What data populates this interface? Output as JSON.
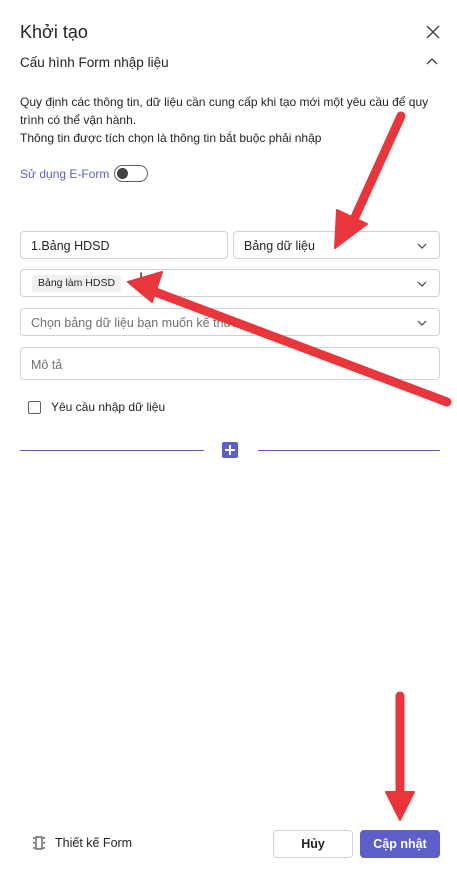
{
  "header": {
    "title": "Khởi tạo",
    "close_icon": "close-icon"
  },
  "section": {
    "title": "Cấu hình Form nhập liệu",
    "collapse_icon": "chevron-up-icon",
    "description_line1": "Quy định các thông tin, dữ liệu cần cung cấp khi tạo mới một yêu cầu để quy trình có thể vận hành.",
    "description_line2": "Thông tin được tích chọn là thông tin bắt buộc phải nhập"
  },
  "eform": {
    "label": "Sử dụng E-Form",
    "enabled": false
  },
  "form": {
    "name_value": "1.Bảng HDSD",
    "type_value": "Bảng dữ liệu",
    "table_tag": "Bảng làm HDSD",
    "choose_placeholder": "Chọn bảng dữ liệu bạn muốn kế thừa",
    "desc_placeholder": "Mô tả",
    "required_label": "Yêu cầu nhập dữ liệu",
    "required_checked": false
  },
  "footer": {
    "design_label": "Thiết kế Form",
    "design_icon": "form-design-icon",
    "cancel_label": "Hủy",
    "update_label": "Cập nhật"
  },
  "colors": {
    "accent": "#5b5fc7",
    "annotation_arrow": "#e8363c"
  }
}
